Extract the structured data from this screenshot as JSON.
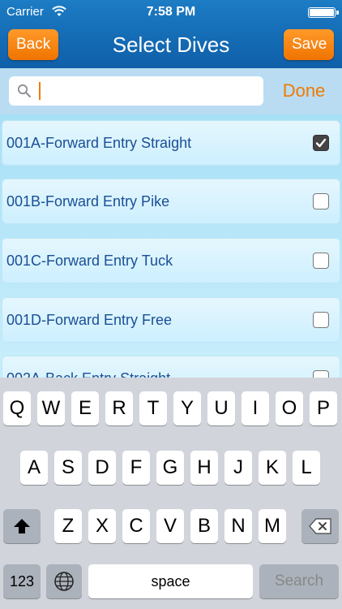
{
  "status_bar": {
    "carrier": "Carrier",
    "time": "7:58 PM"
  },
  "nav": {
    "back_label": "Back",
    "title": "Select Dives",
    "save_label": "Save"
  },
  "search": {
    "value": "",
    "done_label": "Done"
  },
  "dives": [
    {
      "label": "001A-Forward Entry Straight",
      "checked": true
    },
    {
      "label": "001B-Forward Entry Pike",
      "checked": false
    },
    {
      "label": "001C-Forward Entry Tuck",
      "checked": false
    },
    {
      "label": "001D-Forward Entry Free",
      "checked": false
    },
    {
      "label": "002A-Back Entry Straight",
      "checked": false
    }
  ],
  "keyboard": {
    "row1": [
      "Q",
      "W",
      "E",
      "R",
      "T",
      "Y",
      "U",
      "I",
      "O",
      "P"
    ],
    "row2": [
      "A",
      "S",
      "D",
      "F",
      "G",
      "H",
      "J",
      "K",
      "L"
    ],
    "row3": [
      "Z",
      "X",
      "C",
      "V",
      "B",
      "N",
      "M"
    ],
    "numbers_label": "123",
    "space_label": "space",
    "search_label": "Search"
  },
  "colors": {
    "accent": "#f07a00",
    "nav": "#0f5fa9",
    "list_text": "#1a4f96"
  }
}
